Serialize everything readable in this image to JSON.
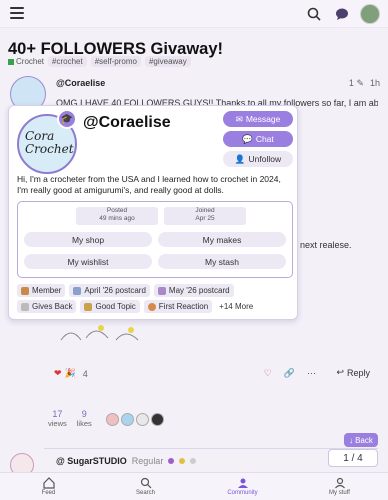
{
  "header": {
    "menu_icon": "hamburger-icon",
    "search_icon": "search-icon",
    "chat_icon": "chat-bubble-icon",
    "avatar_icon": "user-avatar"
  },
  "topic": {
    "title": "40+ FOLLOWERS Givaway!",
    "category": "Crochet",
    "category_color": "#3aa14a",
    "tags": [
      "#crochet",
      "#self-promo",
      "#giveaway"
    ]
  },
  "post": {
    "username": "@Coraelise",
    "edit_count": "1",
    "age": "1h",
    "body_line": "OMG I HAVE 40 FOLLOWERS GUYS!! Thanks to all my followers so far, I am able to do a",
    "release_text": "next realese.",
    "reaction_count": "4",
    "reply_label": "Reply",
    "views_label": "views",
    "views_count": "17",
    "likes_label": "likes",
    "likes_count": "9"
  },
  "user_card": {
    "logo_text_1": "Cora",
    "logo_text_2": "Crochets",
    "name": "@Coraelise",
    "message_label": "Message",
    "chat_label": "Chat",
    "unfollow_label": "Unfollow",
    "bio": "Hi, I'm a crocheter from the USA and I learned how to crochet in 2024, I'm really good at amigurumi's, and really good at dolls.",
    "posted_label": "Posted",
    "posted_value": "49 mins ago",
    "joined_label": "Joined",
    "joined_value": "Apr 25",
    "links": [
      "My shop",
      "My makes",
      "My wishlist",
      "My stash"
    ],
    "badges": [
      {
        "label": "Member",
        "color": "#c98a4a"
      },
      {
        "label": "April '26 postcard",
        "color": "#8aa0c8"
      },
      {
        "label": "May '26 postcard",
        "color": "#a88ac8"
      },
      {
        "label": "Gives Back",
        "color": "#bbbbbb"
      },
      {
        "label": "Good Topic",
        "color": "#c9a24a"
      },
      {
        "label": "First Reaction",
        "color": "#d88a4a"
      }
    ],
    "more_label": "+14 More"
  },
  "nav": {
    "back_label": "Back",
    "page_counter": "1 / 4"
  },
  "next_post": {
    "username": "@ SugarSTUDIO",
    "role": "Regular"
  },
  "bottom_nav": [
    {
      "label": "Feed",
      "icon": "home-icon"
    },
    {
      "label": "Search",
      "icon": "search-icon"
    },
    {
      "label": "Community",
      "icon": "community-icon"
    },
    {
      "label": "My stuff",
      "icon": "user-icon"
    }
  ]
}
